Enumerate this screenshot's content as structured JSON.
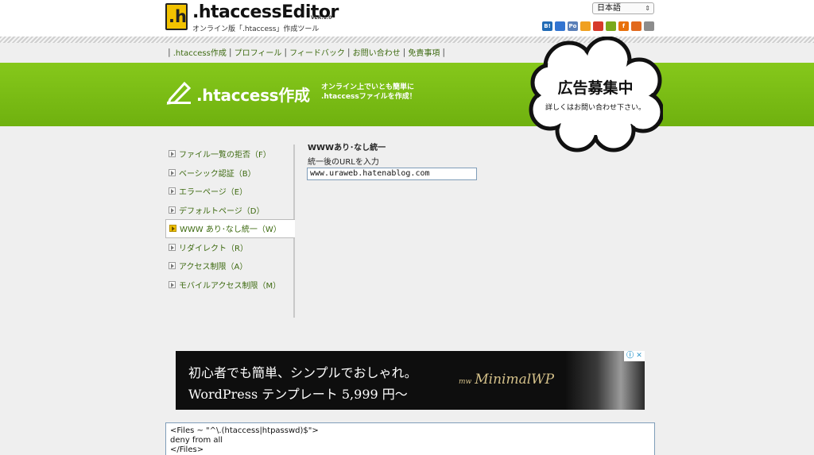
{
  "header": {
    "logo_mark": ".h",
    "logo_text": ".htaccessEditor",
    "logo_version": "VER.1.0",
    "logo_subtitle": "オンライン版「.htaccess」作成ツール",
    "language": "日本語",
    "social_icons": [
      {
        "name": "hatena-bookmark-icon",
        "label": "B!",
        "color": "#1f6ab5"
      },
      {
        "name": "delicious-icon",
        "label": "",
        "color": "#3274d1"
      },
      {
        "name": "livedoor-clip-icon",
        "label": "Po",
        "color": "#5a7fb8"
      },
      {
        "name": "buzzurl-icon",
        "label": "",
        "color": "#f0a020"
      },
      {
        "name": "google-bookmark-icon",
        "label": "",
        "color": "#d63a2a"
      },
      {
        "name": "yahoo-bookmark-icon",
        "label": "",
        "color": "#7aa91c"
      },
      {
        "name": "newsing-icon",
        "label": "f",
        "color": "#e8700a"
      },
      {
        "name": "choix-icon",
        "label": "",
        "color": "#e26a1e"
      },
      {
        "name": "reddit-icon",
        "label": "",
        "color": "#8c8c8c"
      }
    ]
  },
  "nav": {
    "items": [
      "htaccess作成",
      "プロフィール",
      "フィードバック",
      "お問い合わせ",
      "免責事項"
    ]
  },
  "banner": {
    "title": ".htaccess作成",
    "tagline_1": "オンライン上でいとも簡単に",
    "tagline_2": ".htaccessファイルを作成！"
  },
  "ad_cloud": {
    "title": "広告募集中",
    "subtitle": "詳しくはお問い合わせ下さい。"
  },
  "sidebar": {
    "items": [
      {
        "label": "ファイル一覧の拒否（F）",
        "active": false
      },
      {
        "label": "ベーシック認証（B）",
        "active": false
      },
      {
        "label": "エラーページ（E）",
        "active": false
      },
      {
        "label": "デフォルトページ（D）",
        "active": false
      },
      {
        "label": "WWW あり･なし統一（W）",
        "active": true
      },
      {
        "label": "リダイレクト（R）",
        "active": false
      },
      {
        "label": "アクセス制限（A）",
        "active": false
      },
      {
        "label": "モバイルアクセス制限（M）",
        "active": false
      }
    ]
  },
  "main": {
    "title": "WWWあり･なし統一",
    "field_label": "統一後のURLを入力",
    "url_value": "www.uraweb.hatenablog.com"
  },
  "ad_banner": {
    "line1": "初心者でも簡単、シンプルでおしゃれ。",
    "line2": "WordPress テンプレート 5,999 円〜",
    "brand": "MinimalWP",
    "brand_mark": "mw",
    "adchoices": "ⓘ ✕"
  },
  "output": {
    "lines": [
      "<Files ~ \"^\\.(htaccess|htpasswd)$\">",
      "deny from all",
      "</Files>"
    ]
  }
}
